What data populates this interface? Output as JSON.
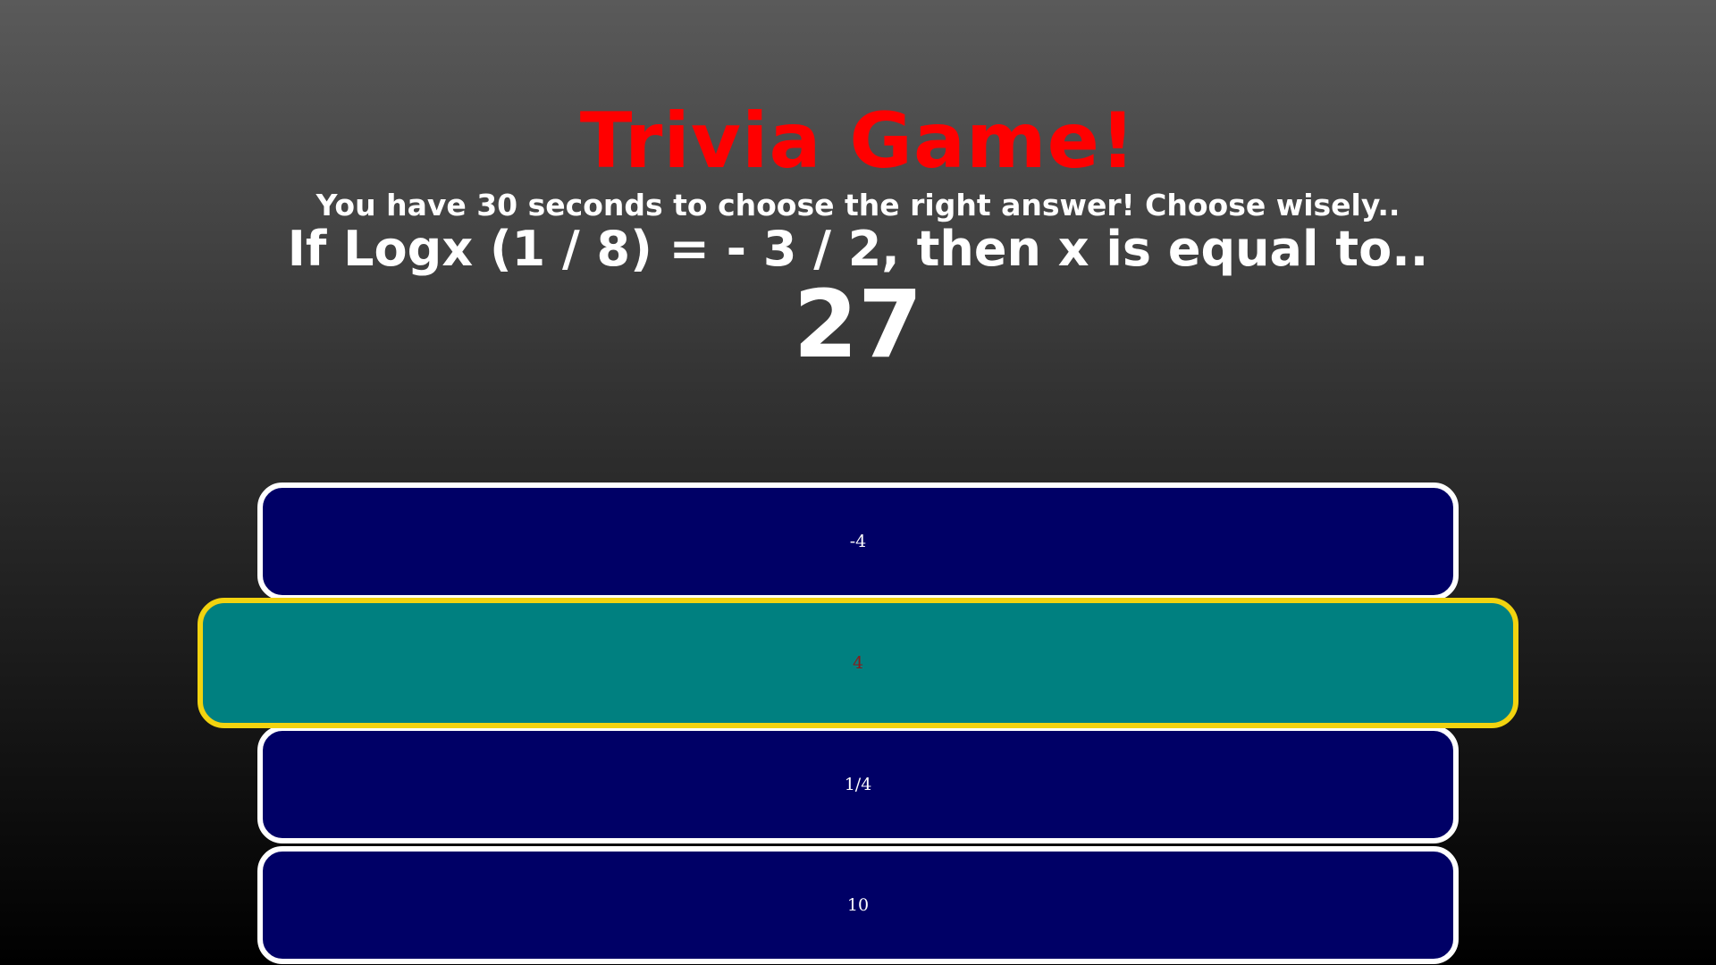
{
  "game": {
    "title": "Trivia Game!",
    "instructions": "You have 30 seconds to choose the right answer! Choose wisely..",
    "question": "If Logx (1 / 8) = - 3 / 2, then x is equal to..",
    "timer": "27"
  },
  "answers": [
    {
      "label": "-4",
      "state": "normal"
    },
    {
      "label": "4",
      "state": "selected"
    },
    {
      "label": "1/4",
      "state": "normal"
    },
    {
      "label": "10",
      "state": "normal"
    }
  ],
  "colors": {
    "title": "#ff0000",
    "answer_bg": "#000066",
    "answer_border": "#ffffff",
    "selected_bg": "#008080",
    "selected_border": "#f2d30f",
    "selected_text": "#8b1a1a"
  }
}
